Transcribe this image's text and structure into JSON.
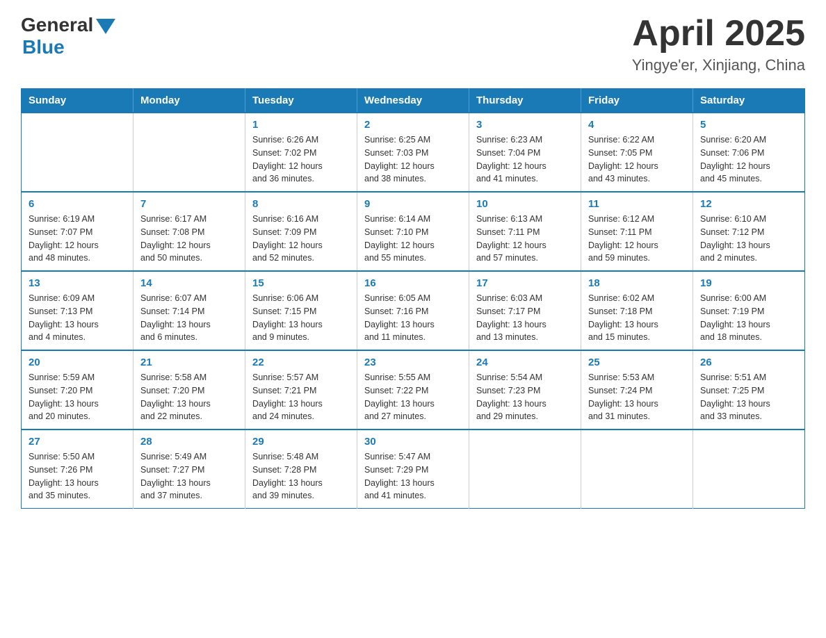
{
  "logo": {
    "general": "General",
    "blue": "Blue"
  },
  "title": {
    "month_year": "April 2025",
    "location": "Yingye'er, Xinjiang, China"
  },
  "days_of_week": [
    "Sunday",
    "Monday",
    "Tuesday",
    "Wednesday",
    "Thursday",
    "Friday",
    "Saturday"
  ],
  "weeks": [
    [
      {
        "day": "",
        "info": ""
      },
      {
        "day": "",
        "info": ""
      },
      {
        "day": "1",
        "info": "Sunrise: 6:26 AM\nSunset: 7:02 PM\nDaylight: 12 hours\nand 36 minutes."
      },
      {
        "day": "2",
        "info": "Sunrise: 6:25 AM\nSunset: 7:03 PM\nDaylight: 12 hours\nand 38 minutes."
      },
      {
        "day": "3",
        "info": "Sunrise: 6:23 AM\nSunset: 7:04 PM\nDaylight: 12 hours\nand 41 minutes."
      },
      {
        "day": "4",
        "info": "Sunrise: 6:22 AM\nSunset: 7:05 PM\nDaylight: 12 hours\nand 43 minutes."
      },
      {
        "day": "5",
        "info": "Sunrise: 6:20 AM\nSunset: 7:06 PM\nDaylight: 12 hours\nand 45 minutes."
      }
    ],
    [
      {
        "day": "6",
        "info": "Sunrise: 6:19 AM\nSunset: 7:07 PM\nDaylight: 12 hours\nand 48 minutes."
      },
      {
        "day": "7",
        "info": "Sunrise: 6:17 AM\nSunset: 7:08 PM\nDaylight: 12 hours\nand 50 minutes."
      },
      {
        "day": "8",
        "info": "Sunrise: 6:16 AM\nSunset: 7:09 PM\nDaylight: 12 hours\nand 52 minutes."
      },
      {
        "day": "9",
        "info": "Sunrise: 6:14 AM\nSunset: 7:10 PM\nDaylight: 12 hours\nand 55 minutes."
      },
      {
        "day": "10",
        "info": "Sunrise: 6:13 AM\nSunset: 7:11 PM\nDaylight: 12 hours\nand 57 minutes."
      },
      {
        "day": "11",
        "info": "Sunrise: 6:12 AM\nSunset: 7:11 PM\nDaylight: 12 hours\nand 59 minutes."
      },
      {
        "day": "12",
        "info": "Sunrise: 6:10 AM\nSunset: 7:12 PM\nDaylight: 13 hours\nand 2 minutes."
      }
    ],
    [
      {
        "day": "13",
        "info": "Sunrise: 6:09 AM\nSunset: 7:13 PM\nDaylight: 13 hours\nand 4 minutes."
      },
      {
        "day": "14",
        "info": "Sunrise: 6:07 AM\nSunset: 7:14 PM\nDaylight: 13 hours\nand 6 minutes."
      },
      {
        "day": "15",
        "info": "Sunrise: 6:06 AM\nSunset: 7:15 PM\nDaylight: 13 hours\nand 9 minutes."
      },
      {
        "day": "16",
        "info": "Sunrise: 6:05 AM\nSunset: 7:16 PM\nDaylight: 13 hours\nand 11 minutes."
      },
      {
        "day": "17",
        "info": "Sunrise: 6:03 AM\nSunset: 7:17 PM\nDaylight: 13 hours\nand 13 minutes."
      },
      {
        "day": "18",
        "info": "Sunrise: 6:02 AM\nSunset: 7:18 PM\nDaylight: 13 hours\nand 15 minutes."
      },
      {
        "day": "19",
        "info": "Sunrise: 6:00 AM\nSunset: 7:19 PM\nDaylight: 13 hours\nand 18 minutes."
      }
    ],
    [
      {
        "day": "20",
        "info": "Sunrise: 5:59 AM\nSunset: 7:20 PM\nDaylight: 13 hours\nand 20 minutes."
      },
      {
        "day": "21",
        "info": "Sunrise: 5:58 AM\nSunset: 7:20 PM\nDaylight: 13 hours\nand 22 minutes."
      },
      {
        "day": "22",
        "info": "Sunrise: 5:57 AM\nSunset: 7:21 PM\nDaylight: 13 hours\nand 24 minutes."
      },
      {
        "day": "23",
        "info": "Sunrise: 5:55 AM\nSunset: 7:22 PM\nDaylight: 13 hours\nand 27 minutes."
      },
      {
        "day": "24",
        "info": "Sunrise: 5:54 AM\nSunset: 7:23 PM\nDaylight: 13 hours\nand 29 minutes."
      },
      {
        "day": "25",
        "info": "Sunrise: 5:53 AM\nSunset: 7:24 PM\nDaylight: 13 hours\nand 31 minutes."
      },
      {
        "day": "26",
        "info": "Sunrise: 5:51 AM\nSunset: 7:25 PM\nDaylight: 13 hours\nand 33 minutes."
      }
    ],
    [
      {
        "day": "27",
        "info": "Sunrise: 5:50 AM\nSunset: 7:26 PM\nDaylight: 13 hours\nand 35 minutes."
      },
      {
        "day": "28",
        "info": "Sunrise: 5:49 AM\nSunset: 7:27 PM\nDaylight: 13 hours\nand 37 minutes."
      },
      {
        "day": "29",
        "info": "Sunrise: 5:48 AM\nSunset: 7:28 PM\nDaylight: 13 hours\nand 39 minutes."
      },
      {
        "day": "30",
        "info": "Sunrise: 5:47 AM\nSunset: 7:29 PM\nDaylight: 13 hours\nand 41 minutes."
      },
      {
        "day": "",
        "info": ""
      },
      {
        "day": "",
        "info": ""
      },
      {
        "day": "",
        "info": ""
      }
    ]
  ]
}
